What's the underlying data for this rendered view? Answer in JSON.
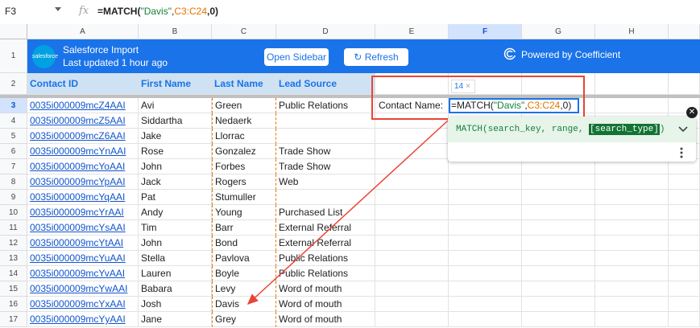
{
  "formula_bar": {
    "cell_ref": "F3",
    "fx_label": "fx",
    "formula_parts": [
      {
        "text": "=MATCH(",
        "cls": "b"
      },
      {
        "text": "\"Davis\"",
        "cls": "g"
      },
      {
        "text": ",",
        "cls": ""
      },
      {
        "text": "C3:C24",
        "cls": "o"
      },
      {
        "text": ",0)",
        "cls": "b"
      }
    ]
  },
  "columns": [
    "A",
    "B",
    "C",
    "D",
    "E",
    "F",
    "G",
    "H"
  ],
  "selected_column": "F",
  "rows": [
    "1",
    "2",
    "3",
    "4",
    "5",
    "6",
    "7",
    "8",
    "9",
    "10",
    "11",
    "12",
    "13",
    "14",
    "15",
    "16",
    "17"
  ],
  "selected_row": "3",
  "banner": {
    "logo_text": "salesforce",
    "title": "Salesforce Import",
    "subtitle": "Last updated 1 hour ago",
    "open_sidebar": "Open Sidebar",
    "refresh": "Refresh",
    "powered_by": "Powered by Coefficient",
    "bg_color": "#1a73e8"
  },
  "headers": {
    "contact_id": "Contact ID",
    "first_name": "First Name",
    "last_name": "Last Name",
    "lead_source": "Lead Source"
  },
  "data_rows": [
    {
      "id": "0035i000009mcZ4AAI",
      "first": "Avi",
      "last": "Green",
      "source": "Public Relations"
    },
    {
      "id": "0035i000009mcZ5AAI",
      "first": "Siddartha",
      "last": "Nedaerk",
      "source": ""
    },
    {
      "id": "0035i000009mcZ6AAI",
      "first": "Jake",
      "last": "Llorrac",
      "source": ""
    },
    {
      "id": "0035i000009mcYnAAI",
      "first": "Rose",
      "last": "Gonzalez",
      "source": "Trade Show"
    },
    {
      "id": "0035i000009mcYoAAI",
      "first": "John",
      "last": "Forbes",
      "source": "Trade Show"
    },
    {
      "id": "0035i000009mcYpAAI",
      "first": "Jack",
      "last": "Rogers",
      "source": "Web"
    },
    {
      "id": "0035i000009mcYqAAI",
      "first": "Pat",
      "last": "Stumuller",
      "source": ""
    },
    {
      "id": "0035i000009mcYrAAI",
      "first": "Andy",
      "last": "Young",
      "source": "Purchased List"
    },
    {
      "id": "0035i000009mcYsAAI",
      "first": "Tim",
      "last": "Barr",
      "source": "External Referral"
    },
    {
      "id": "0035i000009mcYtAAI",
      "first": "John",
      "last": "Bond",
      "source": "External Referral"
    },
    {
      "id": "0035i000009mcYuAAI",
      "first": "Stella",
      "last": "Pavlova",
      "source": "Public Relations"
    },
    {
      "id": "0035i000009mcYvAAI",
      "first": "Lauren",
      "last": "Boyle",
      "source": "Public Relations"
    },
    {
      "id": "0035i000009mcYwAAI",
      "first": "Babara",
      "last": "Levy",
      "source": "Word of mouth"
    },
    {
      "id": "0035i000009mcYxAAI",
      "first": "Josh",
      "last": "Davis",
      "source": "Word of mouth"
    },
    {
      "id": "0035i000009mcYyAAI",
      "first": "Jane",
      "last": "Grey",
      "source": "Word of mouth"
    }
  ],
  "lookup": {
    "label": "Contact Name:",
    "tooltip_value": "14",
    "tooltip_close": "×",
    "edit_parts": [
      {
        "text": "=MATCH(",
        "cls": ""
      },
      {
        "text": "\"Davis\"",
        "cls": "g"
      },
      {
        "text": ",",
        "cls": ""
      },
      {
        "text": "C3:C24",
        "cls": "o"
      },
      {
        "text": ",0)",
        "cls": ""
      }
    ]
  },
  "function_help": {
    "prefix": "MATCH(search_key, range, ",
    "highlight": "[search_type]",
    "suffix": ")",
    "expand_icon": "chevron-down-icon",
    "more_icon": "more-vert-icon",
    "close_icon": "close-icon"
  },
  "colors": {
    "accent": "#1a73e8",
    "annotation": "#ea4335",
    "string": "#188038",
    "range": "#e37400"
  }
}
